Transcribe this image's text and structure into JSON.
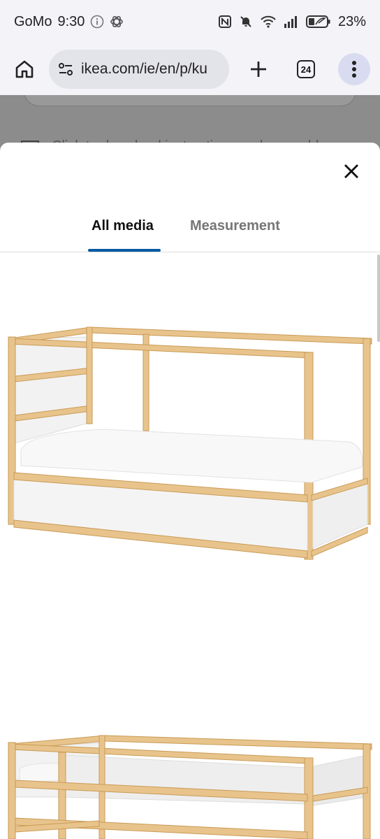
{
  "status_bar": {
    "carrier": "GoMo",
    "time": "9:30",
    "battery": "23%",
    "icons": [
      "info-icon",
      "chatgpt-icon",
      "nfc-icon",
      "mute-icon",
      "wifi-icon",
      "signal-icon",
      "battery-icon"
    ]
  },
  "browser": {
    "url": "ikea.com/ie/en/p/ku",
    "tab_count": "24",
    "icons": [
      "home-icon",
      "site-settings-icon",
      "plus-icon",
      "tabs-icon",
      "more-icon"
    ]
  },
  "page_behind": {
    "partial_text": "Click to download instructions and assembly..."
  },
  "sheet": {
    "tabs": [
      {
        "label": "All media",
        "active": true
      },
      {
        "label": "Measurement",
        "active": false
      }
    ],
    "images": [
      {
        "name": "kura-bed-low-position"
      },
      {
        "name": "kura-bed-high-position"
      }
    ]
  },
  "colors": {
    "accent": "#0058a3",
    "wood": "#e8c48c",
    "panel": "#f4f4f4"
  }
}
